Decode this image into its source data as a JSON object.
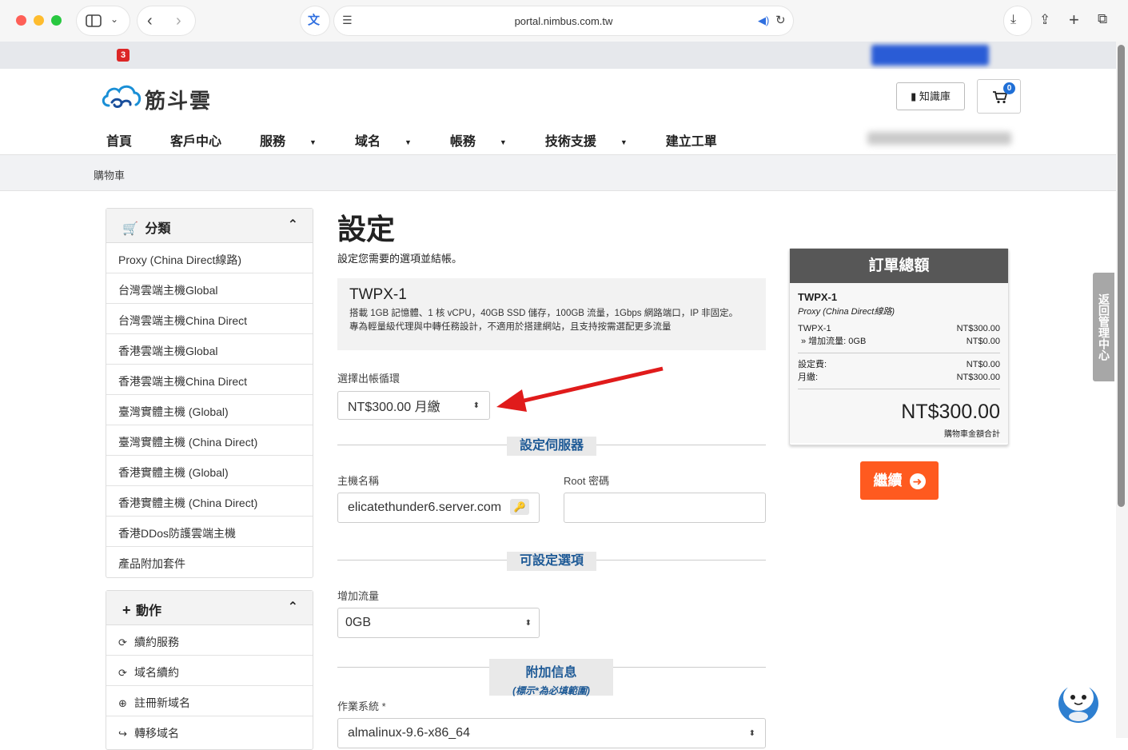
{
  "browser": {
    "url": "portal.nimbus.com.tw",
    "notification_count": "3"
  },
  "header": {
    "logo_text": "筋斗雲",
    "knowledge_base_label": "知識庫",
    "cart_count": "0",
    "nav": [
      {
        "label": "首頁",
        "dropdown": false
      },
      {
        "label": "客戶中心",
        "dropdown": false
      },
      {
        "label": "服務",
        "dropdown": true
      },
      {
        "label": "域名",
        "dropdown": true
      },
      {
        "label": "帳務",
        "dropdown": true
      },
      {
        "label": "技術支援",
        "dropdown": true
      },
      {
        "label": "建立工單",
        "dropdown": false
      }
    ]
  },
  "breadcrumb": "購物車",
  "sidebar": {
    "categories": {
      "title": "分類",
      "items": [
        "Proxy (China Direct線路)",
        "台灣雲端主機Global",
        "台灣雲端主機China Direct",
        "香港雲端主機Global",
        "香港雲端主機China Direct",
        "臺灣實體主機 (Global)",
        "臺灣實體主機 (China Direct)",
        "香港實體主機 (Global)",
        "香港實體主機 (China Direct)",
        "香港DDos防護雲端主機",
        "產品附加套件"
      ]
    },
    "actions": {
      "title": "動作",
      "items": [
        "續約服務",
        "域名續約",
        "註冊新域名",
        "轉移域名"
      ]
    }
  },
  "main": {
    "title": "設定",
    "subtitle": "設定您需要的選項並結帳。",
    "product": {
      "name": "TWPX-1",
      "desc1": "搭載 1GB 記憶體、1 核 vCPU，40GB SSD 儲存，100GB 流量，1Gbps 網路端口，IP 非固定。",
      "desc2": "專為輕量級代理與中轉任務設計，不適用於搭建網站，且支持按需選配更多流量"
    },
    "billing_label": "選擇出帳循環",
    "billing_value": "NT$300.00 月繳",
    "server_section": "設定伺服器",
    "hostname_label": "主機名稱",
    "hostname_value": "elicatethunder6.server.com",
    "root_label": "Root 密碼",
    "root_value": "",
    "options_section": "可設定選項",
    "traffic_label": "增加流量",
    "traffic_value": "0GB",
    "extra_section": "附加信息",
    "extra_hint": "(標示*為必填範圍)",
    "os_label": "作業系統 *",
    "os_value": "almalinux-9.6-x86_64"
  },
  "summary": {
    "title": "訂單總額",
    "product": "TWPX-1",
    "group": "Proxy (China Direct線路)",
    "line1_label": "TWPX-1",
    "line1_value": "NT$300.00",
    "line2_label": "» 增加流量: 0GB",
    "line2_value": "NT$0.00",
    "setup_label": "設定費:",
    "setup_value": "NT$0.00",
    "monthly_label": "月繳:",
    "monthly_value": "NT$300.00",
    "total": "NT$300.00",
    "total_label": "購物車金額合計"
  },
  "continue_label": "繼續",
  "back_tab_label": "返回管理中心",
  "colors": {
    "accent_orange": "#ff5a1f",
    "section_blue": "#1e5a96",
    "summary_header": "#575757",
    "arrow_red": "#e01b1b"
  }
}
